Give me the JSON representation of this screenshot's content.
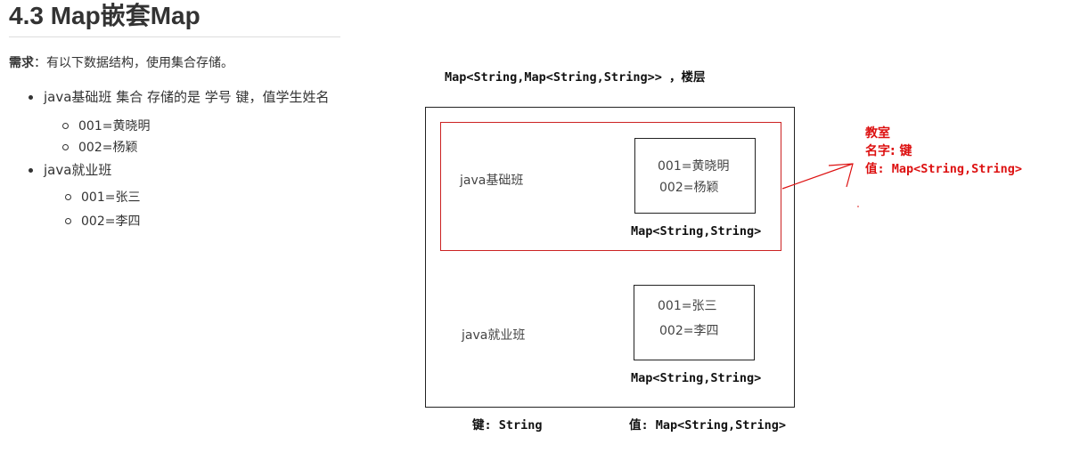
{
  "heading": "4.3 Map嵌套Map",
  "requirement": {
    "label": "需求",
    "text": "：有以下数据结构，使用集合存储。"
  },
  "list": [
    {
      "label": "java基础班 集合 存储的是 学号 键，值学生姓名",
      "items": [
        "001=黄晓明",
        "002=杨颖"
      ]
    },
    {
      "label": "java就业班",
      "items": [
        "001=张三",
        "002=李四"
      ]
    }
  ],
  "diagram": {
    "top_label": "Map<String,Map<String,String>> ，楼层",
    "class1": {
      "name": "java基础班",
      "items": [
        "001=黄晓明",
        "002=杨颖"
      ],
      "map_label": "Map<String,String>"
    },
    "class2": {
      "name": "java就业班",
      "items": [
        "001=张三",
        "002=李四"
      ],
      "map_label": "Map<String,String>"
    },
    "key_label": "键: String",
    "value_label": "值: Map<String,String>",
    "note": {
      "line1": "教室",
      "line2": "名字: 键",
      "line3": "值: Map<String,String>"
    },
    "colors": {
      "annotation": "#dd1111",
      "border": "#222222"
    }
  }
}
